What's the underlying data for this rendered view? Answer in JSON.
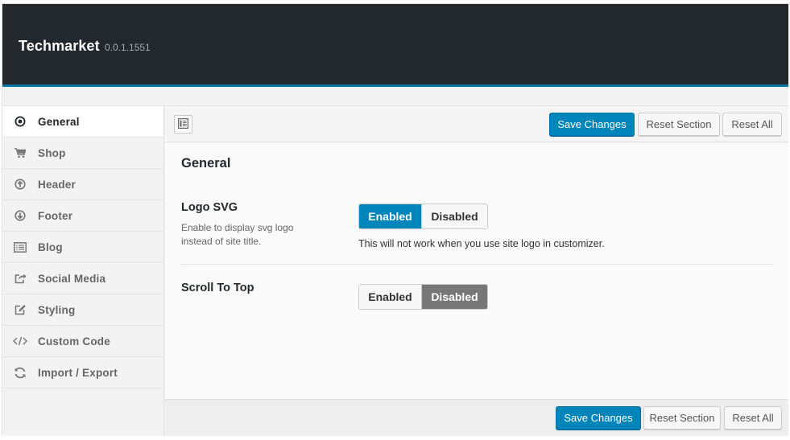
{
  "header": {
    "title": "Techmarket",
    "version": "0.0.1.1551"
  },
  "sidebar": {
    "items": [
      {
        "label": "General",
        "icon": "radio-target-icon",
        "active": true
      },
      {
        "label": "Shop",
        "icon": "cart-icon",
        "active": false
      },
      {
        "label": "Header",
        "icon": "arrow-up-circle-icon",
        "active": false
      },
      {
        "label": "Footer",
        "icon": "arrow-down-circle-icon",
        "active": false
      },
      {
        "label": "Blog",
        "icon": "list-icon",
        "active": false
      },
      {
        "label": "Social Media",
        "icon": "share-icon",
        "active": false
      },
      {
        "label": "Styling",
        "icon": "edit-icon",
        "active": false
      },
      {
        "label": "Custom Code",
        "icon": "code-icon",
        "active": false
      },
      {
        "label": "Import / Export",
        "icon": "refresh-icon",
        "active": false
      }
    ]
  },
  "toolbar": {
    "save_label": "Save Changes",
    "reset_section_label": "Reset Section",
    "reset_all_label": "Reset All"
  },
  "section": {
    "title": "General",
    "fields": [
      {
        "label": "Logo SVG",
        "description": "Enable to display svg logo instead of site title.",
        "enabled_label": "Enabled",
        "disabled_label": "Disabled",
        "value": "Enabled",
        "note": "This will not work when you use site logo in customizer."
      },
      {
        "label": "Scroll To Top",
        "enabled_label": "Enabled",
        "disabled_label": "Disabled",
        "value": "Disabled"
      }
    ]
  },
  "colors": {
    "header_bg": "#23282d",
    "accent": "#0085ba",
    "disabled_selected": "#777777"
  }
}
